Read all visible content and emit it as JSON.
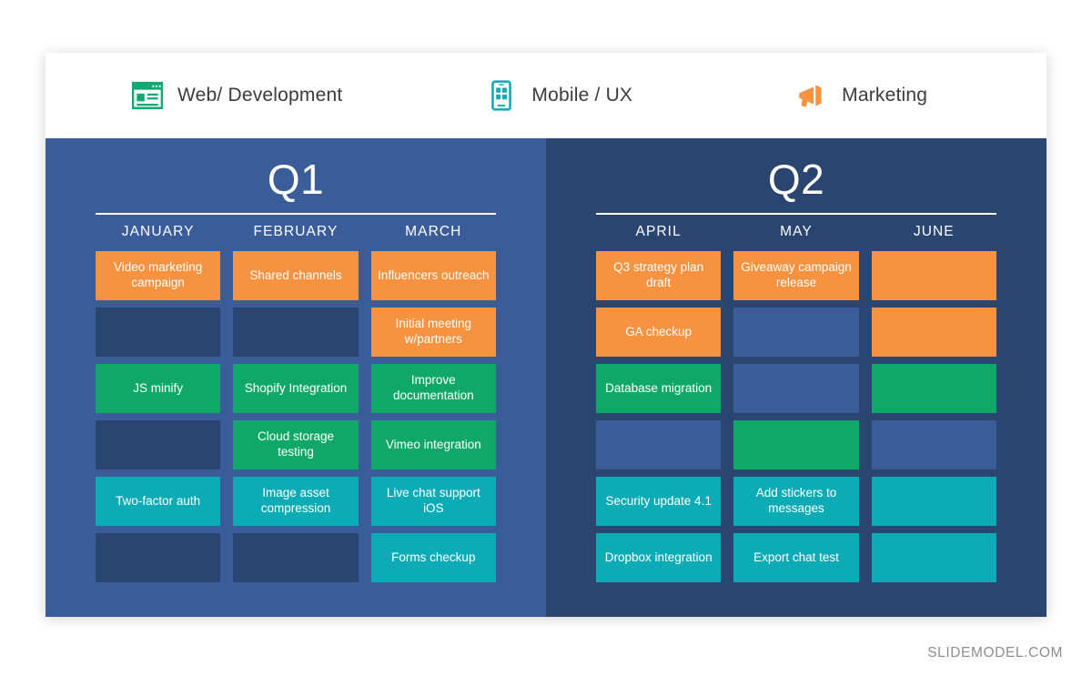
{
  "legend": {
    "items": [
      {
        "label": "Web/ Development",
        "icon": "browser-window-icon",
        "color": "#12a871"
      },
      {
        "label": "Mobile / UX",
        "icon": "mobile-phone-icon",
        "color": "#0dabb5"
      },
      {
        "label": "Marketing",
        "icon": "megaphone-icon",
        "color": "#f79240"
      }
    ]
  },
  "quarters": [
    {
      "title": "Q1",
      "theme": "light",
      "months": [
        "JANUARY",
        "FEBRUARY",
        "MARCH"
      ],
      "columns": [
        [
          {
            "label": "Video marketing campaign",
            "color": "orange"
          },
          {
            "label": "",
            "color": "empty"
          },
          {
            "label": "JS minify",
            "color": "green"
          },
          {
            "label": "",
            "color": "empty"
          },
          {
            "label": "Two-factor auth",
            "color": "teal"
          },
          {
            "label": "",
            "color": "empty"
          }
        ],
        [
          {
            "label": "Shared channels",
            "color": "orange"
          },
          {
            "label": "",
            "color": "empty"
          },
          {
            "label": "Shopify Integration",
            "color": "green"
          },
          {
            "label": "Cloud storage testing",
            "color": "green"
          },
          {
            "label": "Image asset compression",
            "color": "teal"
          },
          {
            "label": "",
            "color": "empty"
          }
        ],
        [
          {
            "label": "Influencers  outreach",
            "color": "orange"
          },
          {
            "label": "Initial meeting w/partners",
            "color": "orange"
          },
          {
            "label": "Improve documentation",
            "color": "green"
          },
          {
            "label": "Vimeo integration",
            "color": "green"
          },
          {
            "label": "Live chat support iOS",
            "color": "teal"
          },
          {
            "label": "Forms checkup",
            "color": "teal"
          }
        ]
      ]
    },
    {
      "title": "Q2",
      "theme": "dark",
      "months": [
        "APRIL",
        "MAY",
        "JUNE"
      ],
      "columns": [
        [
          {
            "label": "Q3 strategy plan draft",
            "color": "orange"
          },
          {
            "label": "GA checkup",
            "color": "orange"
          },
          {
            "label": "Database migration",
            "color": "green"
          },
          {
            "label": "",
            "color": "empty"
          },
          {
            "label": "Security update 4.1",
            "color": "teal"
          },
          {
            "label": "Dropbox integration",
            "color": "teal"
          }
        ],
        [
          {
            "label": "Giveaway campaign release",
            "color": "orange"
          },
          {
            "label": "",
            "color": "empty"
          },
          {
            "label": "",
            "color": "empty"
          },
          {
            "label": "",
            "color": "green"
          },
          {
            "label": "Add stickers to messages",
            "color": "teal"
          },
          {
            "label": "Export chat test",
            "color": "teal"
          }
        ],
        [
          {
            "label": "",
            "color": "orange"
          },
          {
            "label": "",
            "color": "orange"
          },
          {
            "label": "",
            "color": "green"
          },
          {
            "label": "",
            "color": "empty"
          },
          {
            "label": "",
            "color": "teal"
          },
          {
            "label": "",
            "color": "teal"
          }
        ]
      ]
    }
  ],
  "watermark": "SLIDEMODEL.COM",
  "colors": {
    "orange": "#f79240",
    "green": "#0fa868",
    "teal": "#0dabb5",
    "panel_light": "#3a5d99",
    "panel_dark": "#2a4570"
  }
}
